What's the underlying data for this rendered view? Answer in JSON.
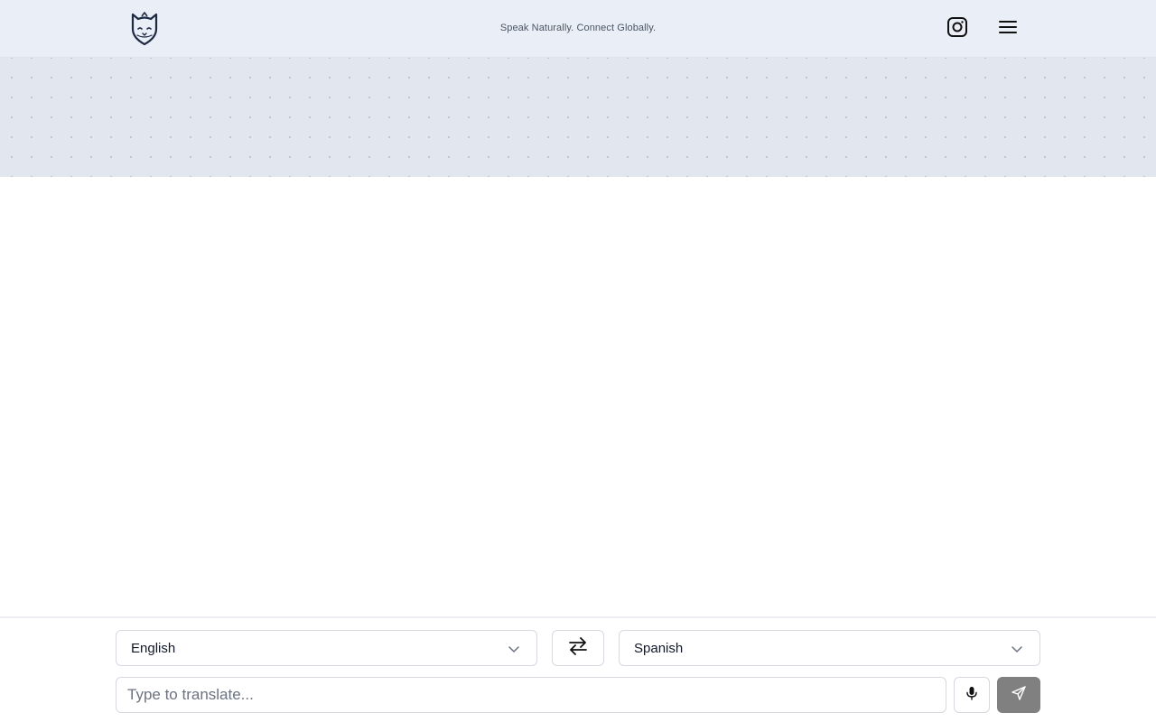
{
  "header": {
    "tagline": "Speak Naturally. Connect Globally.",
    "logo_icon": "cat-shield-logo-icon",
    "instagram_icon": "instagram-icon",
    "menu_icon": "hamburger-menu-icon"
  },
  "translator": {
    "source_language": "English",
    "target_language": "Spanish",
    "swap_icon": "swap-arrows-icon",
    "input_placeholder": "Type to translate...",
    "input_value": "",
    "mic_icon": "microphone-icon",
    "send_icon": "send-icon"
  },
  "colors": {
    "header_bg": "#e9eef7",
    "hero_bg": "#e2e6ef",
    "send_button_bg": "#808080",
    "logo_color": "#1e2a44"
  }
}
